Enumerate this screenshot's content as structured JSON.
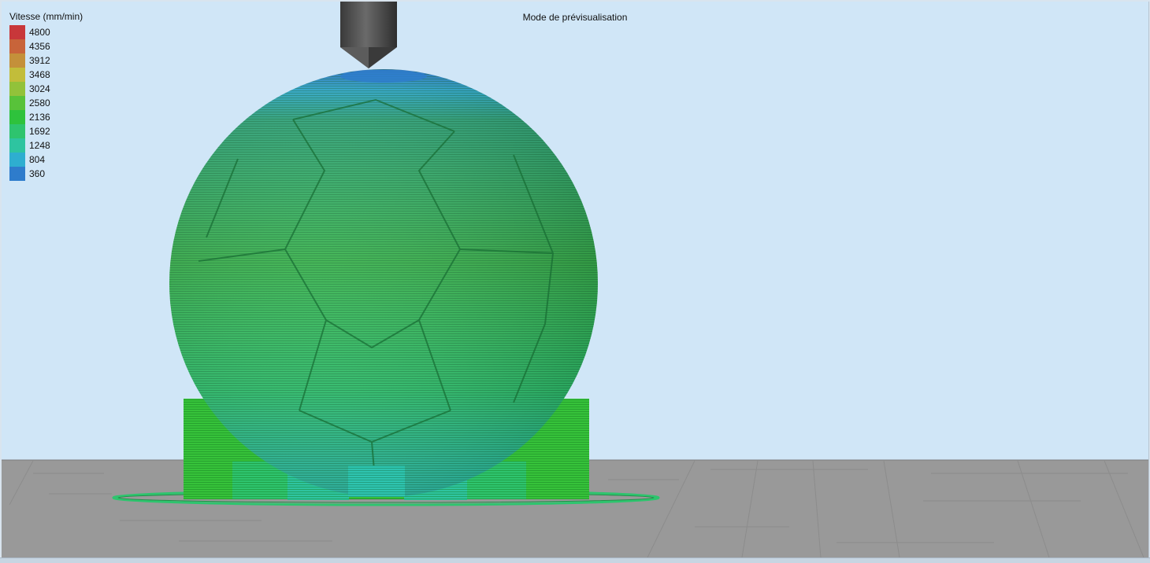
{
  "viewport": {
    "mode_label": "Mode de prévisualisation"
  },
  "legend": {
    "title": "Vitesse (mm/min)",
    "items": [
      {
        "value": "4800",
        "color": "#c8373a"
      },
      {
        "value": "4356",
        "color": "#c8643a"
      },
      {
        "value": "3912",
        "color": "#c4903a"
      },
      {
        "value": "3468",
        "color": "#c2bd3a"
      },
      {
        "value": "3024",
        "color": "#92c23a"
      },
      {
        "value": "2580",
        "color": "#58c23a"
      },
      {
        "value": "2136",
        "color": "#2ec23c"
      },
      {
        "value": "1692",
        "color": "#2ec46e"
      },
      {
        "value": "1248",
        "color": "#2ec4a0"
      },
      {
        "value": "804",
        "color": "#2eaed0"
      },
      {
        "value": "360",
        "color": "#2e7ccc"
      }
    ]
  },
  "scene": {
    "bed_color": "#999999",
    "nozzle_color": "#4a4a4a",
    "model_colors": [
      "#2e7ccc",
      "#2eaed0",
      "#2ec4a0",
      "#2ec46e",
      "#2ec23c",
      "#58c23a"
    ]
  }
}
